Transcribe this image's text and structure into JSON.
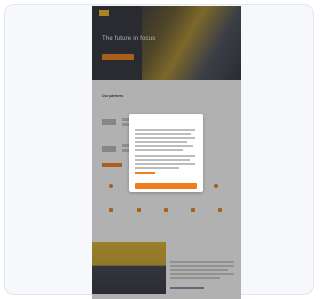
{
  "hero": {
    "title": "The future in focus",
    "subtitle": "",
    "cta_label": ""
  },
  "partners": {
    "title": "Our partners"
  },
  "features_row1": [
    "",
    "",
    "",
    ""
  ],
  "features_row2": [
    "",
    "",
    "",
    "",
    ""
  ],
  "team": {
    "headline": ""
  },
  "cookie_modal": {
    "title": "",
    "accept_label": "",
    "secondary_label": ""
  },
  "colors": {
    "accent": "#ef7d1a",
    "brand_yellow": "#f3b326",
    "hero_dark": "#2a2d36",
    "overlay": "rgba(40,40,40,0.35)"
  }
}
